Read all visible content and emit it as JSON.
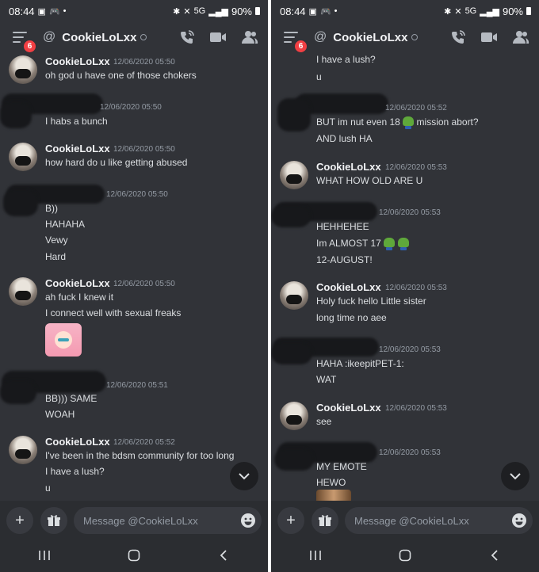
{
  "status_bar": {
    "time": "08:44",
    "battery": "90%",
    "network": "5G",
    "dot": "•"
  },
  "header": {
    "title": "CookieLoLxx",
    "badge_count": "6",
    "at_symbol": "@"
  },
  "input": {
    "placeholder": "Message @CookieLoLxx"
  },
  "left_panel": {
    "messages": [
      {
        "author": "CookieLoLxx",
        "timestamp": "12/06/2020 05:50",
        "lines": [
          "oh god u have one of those chokers"
        ]
      },
      {
        "author": "",
        "timestamp": "12/06/2020 05:50",
        "lines": [
          "I habs a bunch"
        ]
      },
      {
        "author": "CookieLoLxx",
        "timestamp": "12/06/2020 05:50",
        "lines": [
          "how hard do u like getting abused"
        ]
      },
      {
        "author": "",
        "timestamp": "12/06/2020 05:50",
        "lines": [
          "B))",
          "HAHAHA",
          "Vewy",
          "Hard"
        ]
      },
      {
        "author": "CookieLoLxx",
        "timestamp": "12/06/2020 05:50",
        "lines": [
          "ah fuck I knew it",
          "I connect well with sexual freaks"
        ]
      },
      {
        "author": "",
        "timestamp": "12/06/2020 05:51",
        "lines": [
          "BB))) SAME",
          "WOAH"
        ]
      },
      {
        "author": "CookieLoLxx",
        "timestamp": "12/06/2020 05:52",
        "lines": [
          "I've been in the bdsm community for too long",
          "I have a lush?",
          "u"
        ]
      }
    ]
  },
  "right_panel": {
    "top_lines": [
      "I have a lush?",
      "u"
    ],
    "messages": [
      {
        "author": "",
        "timestamp": "12/06/2020 05:52",
        "lines": [
          "BUT im nut even 18",
          "mission abort?",
          "AND lush HA"
        ]
      },
      {
        "author": "CookieLoLxx",
        "timestamp": "12/06/2020 05:53",
        "lines": [
          "WHAT HOW OLD ARE U"
        ]
      },
      {
        "author": "",
        "timestamp": "12/06/2020 05:53",
        "lines": [
          "HEHHEHEE",
          "Im ALMOST 17",
          "12-AUGUST!"
        ]
      },
      {
        "author": "CookieLoLxx",
        "timestamp": "12/06/2020 05:53",
        "lines": [
          "Holy fuck hello Little sister",
          "long time no aee"
        ]
      },
      {
        "author": "",
        "timestamp": "12/06/2020 05:53",
        "lines": [
          "HAHA :ikeepitPET-1:",
          "WAT"
        ]
      },
      {
        "author": "CookieLoLxx",
        "timestamp": "12/06/2020 05:53",
        "lines": [
          "see"
        ]
      },
      {
        "author": "",
        "timestamp": "12/06/2020 05:53",
        "lines": [
          "MY EMOTE",
          "HEWO"
        ]
      }
    ]
  },
  "colors": {
    "background": "#313338",
    "input_bar": "#2b2d31",
    "badge": "#f23f43"
  },
  "icons": [
    "menu-icon",
    "call-icon",
    "video-icon",
    "members-icon",
    "plus-icon",
    "gift-icon",
    "emoji-icon",
    "chevron-down-icon",
    "recents-icon",
    "home-icon",
    "back-icon"
  ]
}
